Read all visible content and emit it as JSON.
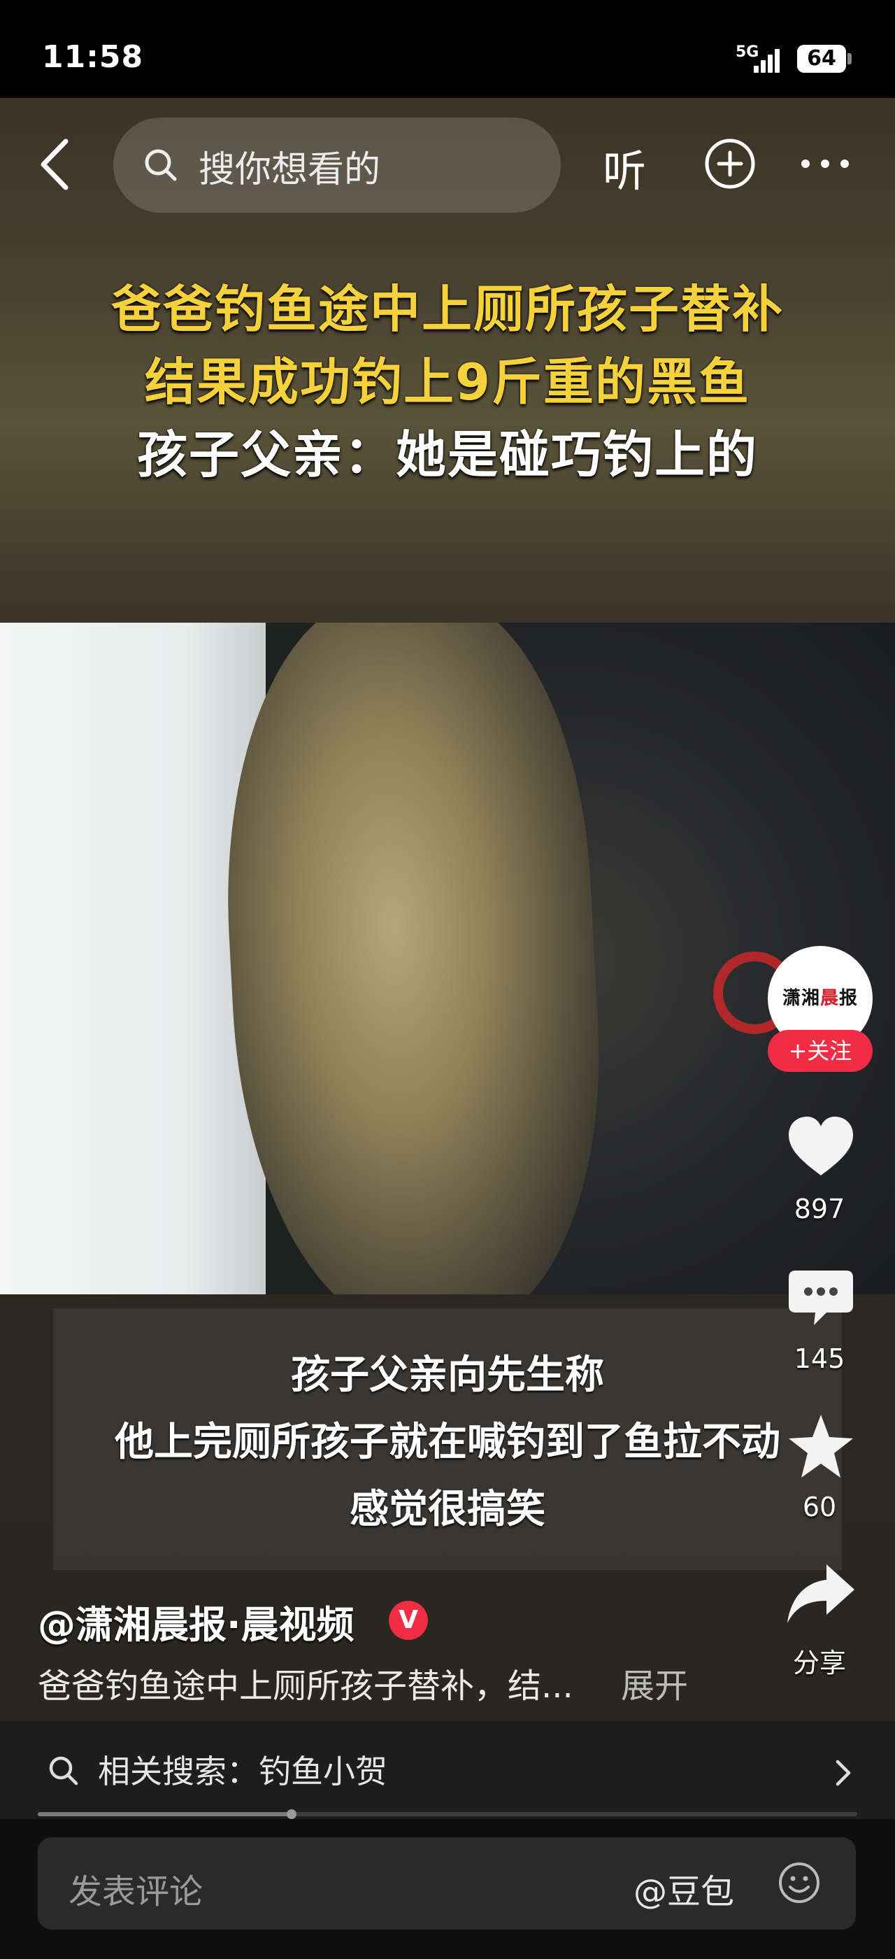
{
  "status_bar": {
    "time": "11:58",
    "network": "5G",
    "battery": "64"
  },
  "search": {
    "placeholder": "搜你想看的"
  },
  "top_nav": {
    "listen_label": "听"
  },
  "video": {
    "title_lines": [
      "爸爸钓鱼途中上厕所孩子替补",
      "结果成功钓上9斤重的黑鱼",
      "孩子父亲：她是碰巧钓上的"
    ],
    "subtitle_lines": [
      "孩子父亲向先生称",
      "他上完厕所孩子就在喊钓到了鱼拉不动",
      "感觉很搞笑"
    ]
  },
  "author": {
    "avatar_text_black_1": "潇湘",
    "avatar_text_red": "晨",
    "avatar_text_black_2": "报",
    "follow_label": "+关注",
    "name": "@潇湘晨报·晨视频",
    "verified_badge": "V"
  },
  "actions": {
    "like_count": "897",
    "comment_count": "145",
    "favorite_count": "60",
    "share_label": "分享"
  },
  "description": {
    "text": "爸爸钓鱼途中上厕所孩子替补，结...",
    "expand_label": "展开"
  },
  "related_search": {
    "text": "相关搜索：钓鱼小贺"
  },
  "playback": {
    "progress": 0.31
  },
  "comment_bar": {
    "placeholder": "发表评论",
    "mention": "@豆包"
  },
  "colors": {
    "accent": "#f02d45",
    "title_yellow": "#f5d23c"
  }
}
